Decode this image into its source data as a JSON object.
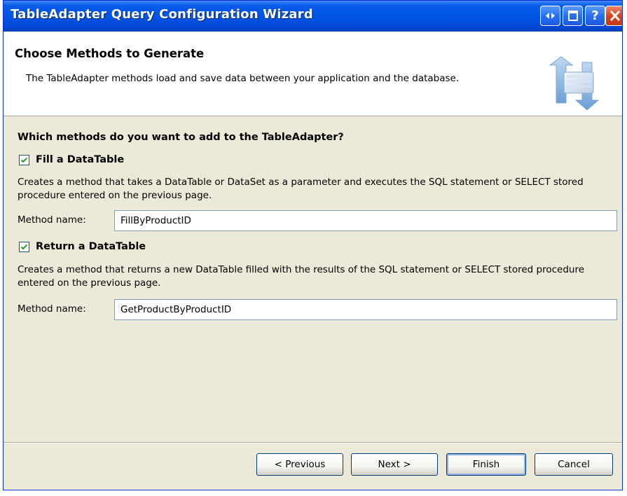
{
  "window": {
    "title": "TableAdapter Query Configuration Wizard"
  },
  "title_buttons": {
    "extra_icon": "scroll-arrows-icon",
    "restore_icon": "restore-icon",
    "help_label": "?",
    "close_icon": "close-icon"
  },
  "header": {
    "title": "Choose Methods to Generate",
    "description": "The TableAdapter methods load and save data between your application and the database.",
    "icon": "data-transfer-icon"
  },
  "main": {
    "question": "Which methods do you want to add to the TableAdapter?",
    "fill": {
      "checked": true,
      "label": "Fill a DataTable",
      "description": "Creates a method that takes a DataTable or DataSet as a parameter and executes the SQL statement or SELECT stored procedure entered on the previous page.",
      "method_label": "Method name:",
      "method_value": "FillByProductID"
    },
    "return": {
      "checked": true,
      "label": "Return a DataTable",
      "description": "Creates a method that returns a new DataTable filled with the results of the SQL statement or SELECT stored procedure entered on the previous page.",
      "method_label": "Method name:",
      "method_value": "GetProductByProductID"
    }
  },
  "footer": {
    "previous": "< Previous",
    "next": "Next >",
    "finish": "Finish",
    "cancel": "Cancel"
  },
  "colors": {
    "titlebar": "#0055e5",
    "window_bg": "#ece9d8",
    "header_bg": "#ffffff",
    "close_button": "#d9441c"
  }
}
